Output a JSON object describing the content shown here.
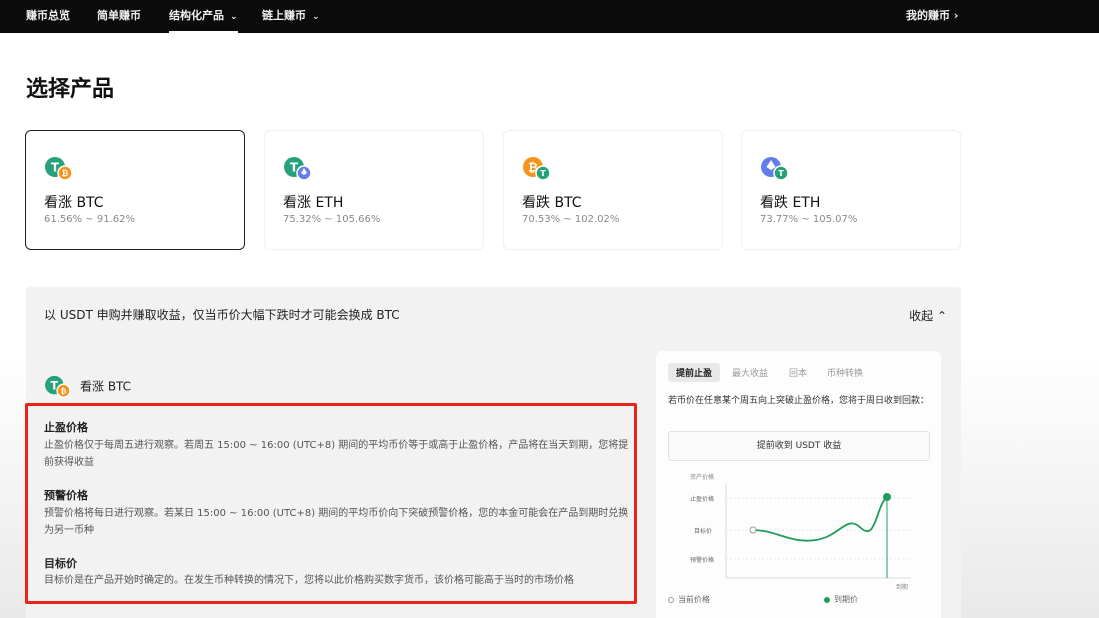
{
  "nav": {
    "items": [
      {
        "label": "赚币总览"
      },
      {
        "label": "简单赚币"
      },
      {
        "label": "结构化产品"
      },
      {
        "label": "链上赚币"
      }
    ],
    "right": "我的赚币 ›"
  },
  "page": {
    "title": "选择产品"
  },
  "products": [
    {
      "name": "看涨 BTC",
      "range": "61.56% ~ 91.62%"
    },
    {
      "name": "看涨 ETH",
      "range": "75.32% ~ 105.66%"
    },
    {
      "name": "看跌 BTC",
      "range": "70.53% ~ 102.02%"
    },
    {
      "name": "看跌 ETH",
      "range": "73.77% ~ 105.07%"
    }
  ],
  "detail": {
    "description": "以 USDT 申购并赚取收益，仅当币价大幅下跌时才可能会换成 BTC",
    "collapse": "收起",
    "product_title": "看涨 BTC",
    "sections": [
      {
        "title": "止盈价格",
        "text": "止盈价格仅于每周五进行观察。若周五 15:00 ~ 16:00 (UTC+8) 期间的平均币价等于或高于止盈价格，产品将在当天到期，您将提前获得收益"
      },
      {
        "title": "预警价格",
        "text": "预警价格将每日进行观察。若某日 15:00 ~ 16:00 (UTC+8) 期间的平均币价向下突破预警价格，您的本金可能会在产品到期时兑换为另一币种"
      },
      {
        "title": "目标价",
        "text": "目标价是在产品开始时确定的。在发生币种转换的情况下，您将以此价格购买数字货币，该价格可能高于当时的市场价格"
      }
    ]
  },
  "chart_card": {
    "tabs": [
      "提前止盈",
      "最大收益",
      "回本",
      "币种转换"
    ],
    "description": "若币价在任意某个周五向上突破止盈价格，您将于周日收到回款：",
    "cta": "提前收到 USDT 收益",
    "y_axis_title": "资产价格",
    "levels": [
      "止盈价格",
      "目标价",
      "预警价格"
    ],
    "x_axis_label": "到期",
    "legend": [
      "当前价格",
      "到期价"
    ],
    "colors": {
      "accent": "#1e9e5b",
      "danger": "#e8241b"
    }
  }
}
